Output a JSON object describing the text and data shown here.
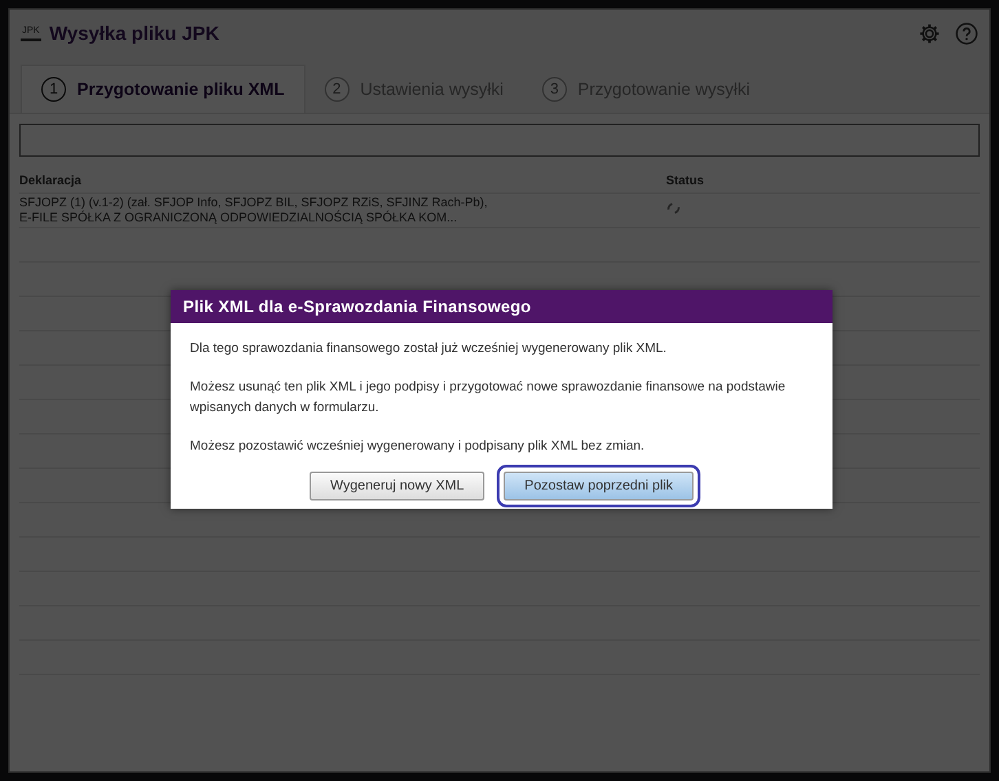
{
  "window": {
    "logo": "JPK",
    "title": "Wysyłka pliku JPK"
  },
  "tabs": [
    {
      "number": "1",
      "label": "Przygotowanie pliku XML",
      "selected": true
    },
    {
      "number": "2",
      "label": "Ustawienia wysyłki",
      "selected": false
    },
    {
      "number": "3",
      "label": "Przygotowanie wysyłki",
      "selected": false
    }
  ],
  "table": {
    "columns": [
      "Deklaracja",
      "Status"
    ],
    "rows": [
      {
        "declaration": "SFJOPZ (1) (v.1-2) (zał. SFJOP Info, SFJOPZ BIL, SFJOPZ RZiS, SFJINZ Rach-Pb), E-FILE SPÓŁKA Z OGRANICZONĄ ODPOWIEDZIALNOŚCIĄ SPÓŁKA KOM...",
        "loading": true
      }
    ]
  },
  "dialog": {
    "title": "Plik XML dla e-Sprawozdania Finansowego",
    "paragraphs": [
      "Dla tego sprawozdania finansowego został już wcześniej wygenerowany plik XML.",
      "Możesz usunąć ten plik XML i jego podpisy i przygotować nowe sprawozdanie finansowe na podstawie wpisanych danych w formularzu.",
      "Możesz pozostawić wcześniej wygenerowany i podpisany plik XML bez zmian."
    ],
    "buttons": [
      {
        "label": "Wygeneruj nowy XML",
        "focused": false
      },
      {
        "label": "Pozostaw poprzedni plik",
        "focused": true
      }
    ]
  }
}
